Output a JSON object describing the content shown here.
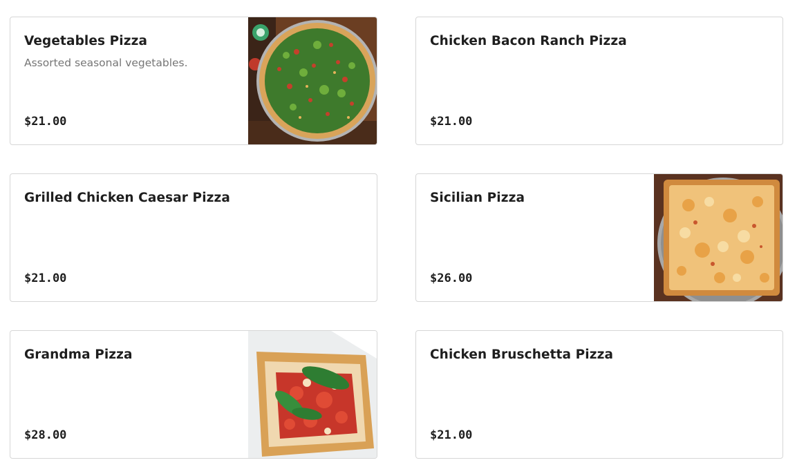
{
  "menu": {
    "items": [
      {
        "name": "Vegetables Pizza",
        "description": "Assorted seasonal vegetables.",
        "price": "$21.00",
        "image": "vegetable-pizza-photo"
      },
      {
        "name": "Chicken Bacon Ranch Pizza",
        "description": "",
        "price": "$21.00",
        "image": null
      },
      {
        "name": "Grilled Chicken Caesar Pizza",
        "description": "",
        "price": "$21.00",
        "image": null
      },
      {
        "name": "Sicilian Pizza",
        "description": "",
        "price": "$26.00",
        "image": "sicilian-pizza-photo"
      },
      {
        "name": "Grandma Pizza",
        "description": "",
        "price": "$28.00",
        "image": "grandma-pizza-photo"
      },
      {
        "name": "Chicken Bruschetta Pizza",
        "description": "",
        "price": "$21.00",
        "image": null
      }
    ]
  }
}
